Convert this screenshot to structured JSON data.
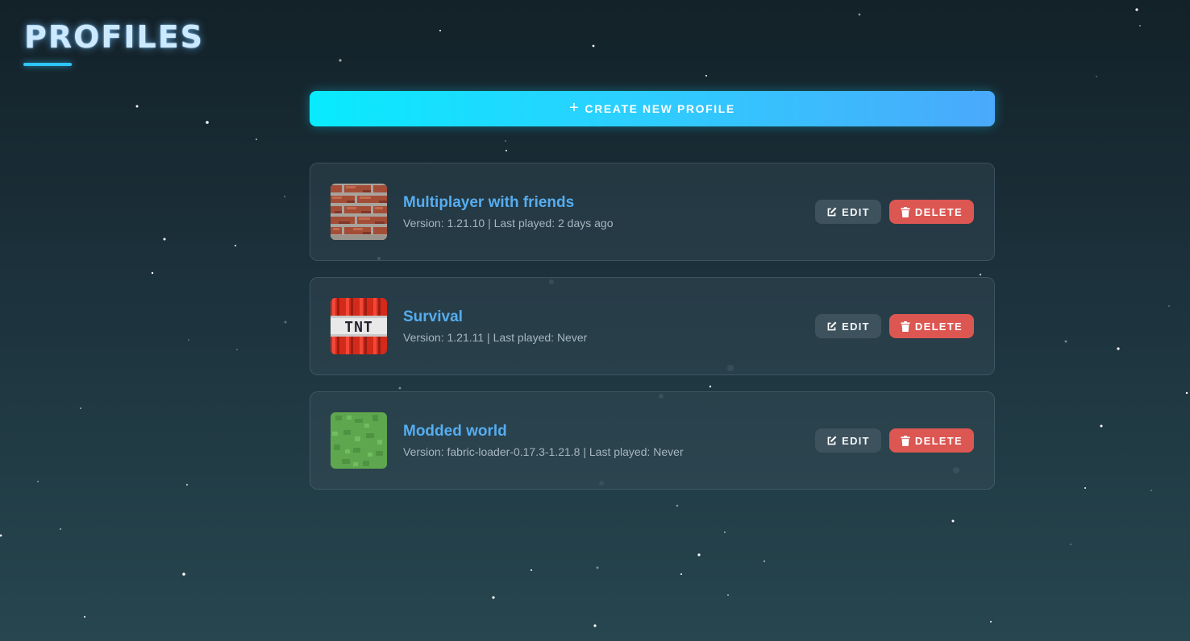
{
  "page": {
    "title": "PROFILES"
  },
  "create_button": {
    "icon": "plus-icon",
    "label": "CREATE NEW PROFILE"
  },
  "colors": {
    "accent_cyan": "#08ebfe",
    "accent_blue": "#4aa9fb",
    "profile_name": "#56adf0",
    "delete_red": "#dc5652",
    "edit_gray": "#3e525d",
    "background_top": "#132128",
    "background_bottom": "#27464f"
  },
  "profiles": [
    {
      "name": "Multiplayer with friends",
      "meta": "Version: 1.21.10 | Last played: 2 days ago",
      "icon": "brick-block-icon",
      "edit_label": "EDIT",
      "delete_label": "DELETE"
    },
    {
      "name": "Survival",
      "meta": "Version: 1.21.11 | Last played: Never",
      "icon": "tnt-block-icon",
      "icon_text": "TNT",
      "edit_label": "EDIT",
      "delete_label": "DELETE"
    },
    {
      "name": "Modded world",
      "meta": "Version: fabric-loader-0.17.3-1.21.8 | Last played: Never",
      "icon": "grass-block-icon",
      "edit_label": "EDIT",
      "delete_label": "DELETE"
    }
  ]
}
